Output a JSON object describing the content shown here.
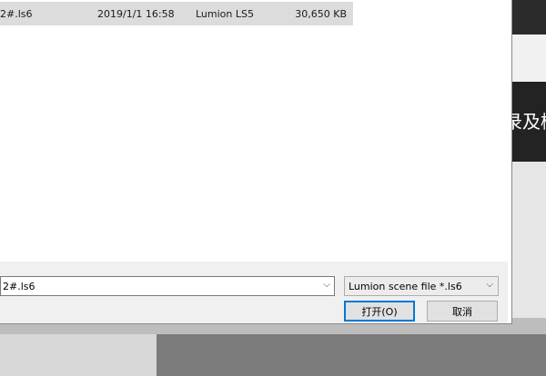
{
  "background": {
    "banner_text": "录及榜"
  },
  "file_list": {
    "selected_row": {
      "name": "2#.ls6",
      "date": "2019/1/1 16:58",
      "type": "Lumion LS5",
      "size": "30,650 KB"
    }
  },
  "footer": {
    "filename_value": "2#.ls6",
    "file_type_filter": "Lumion scene file *.ls6",
    "open_label": "打开(O)",
    "cancel_label": "取消"
  },
  "icons": {
    "dropdown": "chevron-down-icon"
  }
}
